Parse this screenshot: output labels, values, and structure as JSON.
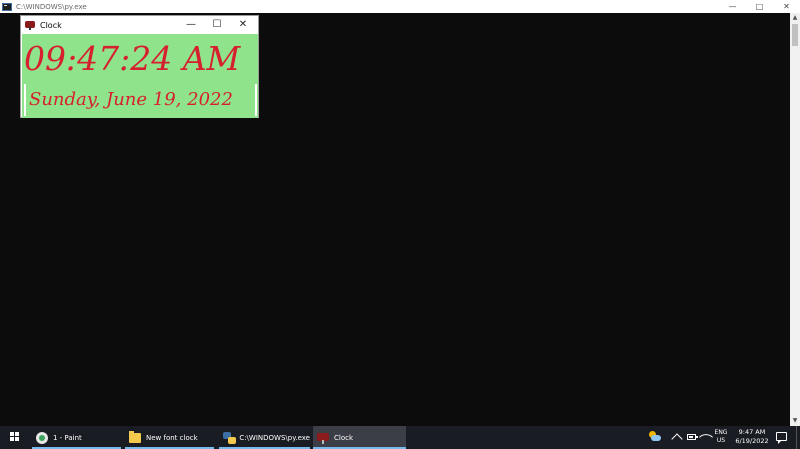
{
  "console": {
    "title": "C:\\WINDOWS\\py.exe",
    "controls": {
      "minimize": "—",
      "maximize": "□",
      "close": "✕"
    }
  },
  "clock_window": {
    "title": "Clock",
    "controls": {
      "minimize": "—",
      "maximize": "☐",
      "close": "✕"
    },
    "time": "09:47:24 AM",
    "date": "Sunday, June 19, 2022",
    "background_color": "#8fe38a",
    "text_color": "#d61f2f"
  },
  "taskbar": {
    "items": [
      {
        "label": "1 - Paint",
        "icon": "paint-icon"
      },
      {
        "label": "New font clock",
        "icon": "folder-icon"
      },
      {
        "label": "C:\\WINDOWS\\py.exe",
        "icon": "python-icon"
      },
      {
        "label": "Clock",
        "icon": "clock-app-icon",
        "active": true
      }
    ],
    "tray": {
      "lang_line1": "ENG",
      "lang_line2": "US",
      "time": "9:47 AM",
      "date": "6/19/2022"
    },
    "accent_color": "#76b9ed"
  }
}
